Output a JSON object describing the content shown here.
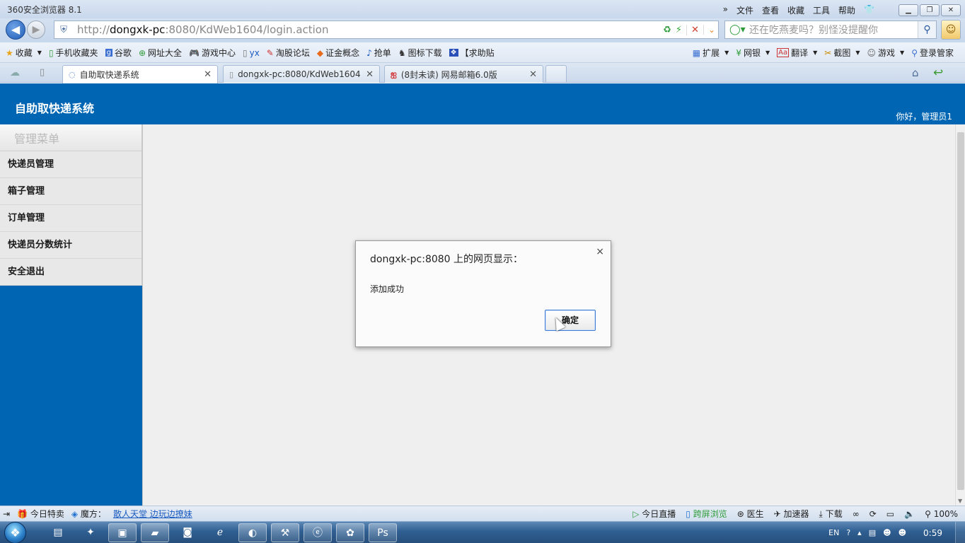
{
  "browser": {
    "title": "360安全浏览器 8.1",
    "menu": [
      "文件",
      "查看",
      "收藏",
      "工具",
      "帮助"
    ],
    "url": {
      "prefix": "http://",
      "host": "dongxk-pc",
      "rest": ":8080/KdWeb1604/login.action"
    },
    "search_placeholder": "还在吃燕麦吗？别怪没提醒你",
    "favorites_left": [
      {
        "icon": "star-icon",
        "label": "收藏"
      },
      {
        "icon": "phone-icon",
        "label": "手机收藏夹"
      },
      {
        "icon": "google-icon",
        "label": "谷歌"
      },
      {
        "icon": "plus-globe-icon",
        "label": "网址大全"
      },
      {
        "icon": "gamepad-icon",
        "label": "游戏中心"
      },
      {
        "icon": "page-icon",
        "label": "yx"
      },
      {
        "icon": "forum-icon",
        "label": "淘股论坛"
      },
      {
        "icon": "concept-icon",
        "label": "证金概念"
      },
      {
        "icon": "grab-icon",
        "label": "抢单"
      },
      {
        "icon": "download-icon",
        "label": "图标下载"
      },
      {
        "icon": "baidu-paw-icon",
        "label": "【求助贴"
      }
    ],
    "favorites_right": [
      {
        "icon": "extension-icon",
        "label": "扩展"
      },
      {
        "icon": "bank-icon",
        "label": "网银"
      },
      {
        "icon": "translate-icon",
        "label": "翻译"
      },
      {
        "icon": "screenshot-icon",
        "label": "截图"
      },
      {
        "icon": "game-icon",
        "label": "游戏"
      },
      {
        "icon": "manager-icon",
        "label": "登录管家"
      }
    ],
    "tabs": [
      {
        "label": "自助取快递系统",
        "active": true
      },
      {
        "label": "dongxk-pc:8080/KdWeb1604",
        "active": false
      },
      {
        "label": "(8封未读) 网易邮箱6.0版",
        "active": false
      }
    ]
  },
  "page": {
    "system_title": "自助取快递系统",
    "greeting": "你好，管理员1",
    "menu_heading": "管理菜单",
    "menu_items": [
      "快递员管理",
      "箱子管理",
      "订单管理",
      "快递员分数统计",
      "安全退出"
    ]
  },
  "dialog": {
    "title": "dongxk-pc:8080 上的网页显示：",
    "message": "添加成功",
    "ok_label": "确定",
    "close_glyph": "×"
  },
  "status": {
    "left": [
      "今日特卖",
      "魔方："
    ],
    "link": "散人天堂 边玩边撩妹",
    "right": [
      "今日直播",
      "跨屏浏览",
      "医生",
      "加速器",
      "下载"
    ],
    "zoom": "100%"
  },
  "taskbar": {
    "lang": "EN",
    "clock": "0:59"
  },
  "colors": {
    "header_blue": "#0066b3",
    "dialog_ok_border": "#3d7bd6"
  }
}
